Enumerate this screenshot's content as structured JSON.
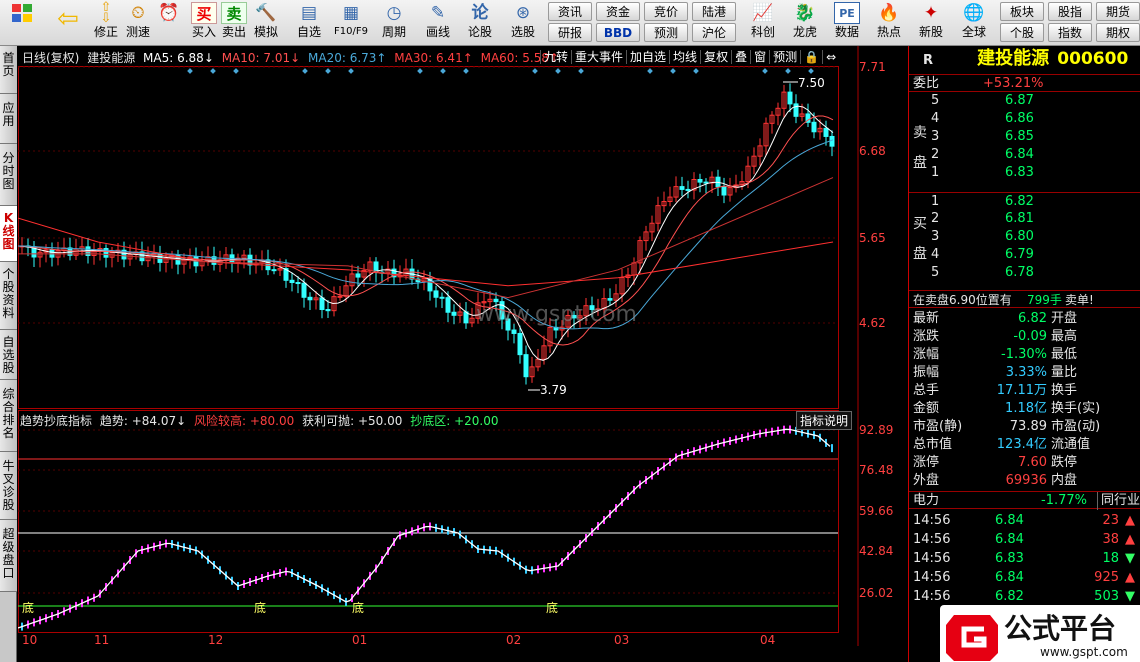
{
  "toolbar": {
    "buttons": [
      {
        "label": "",
        "icon": "grid-icon"
      },
      {
        "label": "",
        "icon": "back-icon"
      },
      {
        "label": "修正",
        "icon": "up-down-icon"
      },
      {
        "label": "测速",
        "icon": "speed-icon"
      },
      {
        "label": "模拟",
        "icon": "clock-icon"
      },
      {
        "label": "买入",
        "icon": "buy-icon",
        "glyph": "买"
      },
      {
        "label": "卖出",
        "icon": "sell-icon",
        "glyph": "卖"
      },
      {
        "label": "模拟",
        "icon": "hammer-icon"
      },
      {
        "label": "自选",
        "icon": "watchlist-icon"
      },
      {
        "label": "F10/F9",
        "icon": "f10-icon"
      },
      {
        "label": "周期",
        "icon": "period-icon"
      },
      {
        "label": "画线",
        "icon": "pen-icon"
      },
      {
        "label": "论股",
        "icon": "forum-icon"
      },
      {
        "label": "选股",
        "icon": "select-stock-icon"
      }
    ],
    "small_top": [
      "资讯",
      "资金",
      "竞价",
      "陆港"
    ],
    "small_bottom": [
      "研报",
      "BBD",
      "预测",
      "沪伦"
    ],
    "buttons2": [
      {
        "label": "科创",
        "icon": "kechuang-icon"
      },
      {
        "label": "龙虎",
        "icon": "dragon-icon"
      },
      {
        "label": "数据",
        "icon": "pe-icon",
        "glyph": "PE"
      },
      {
        "label": "热点",
        "icon": "hot-icon"
      },
      {
        "label": "新股",
        "icon": "new-stock-icon"
      },
      {
        "label": "全球",
        "icon": "globe-icon"
      }
    ],
    "small_right_top": [
      "板块",
      "股指",
      "期货"
    ],
    "small_right_bottom": [
      "个股",
      "指数",
      "期权"
    ]
  },
  "left_tabs": [
    "首页",
    "应用",
    "分时图",
    "K线图",
    "个股资料",
    "自选股",
    "综合排名",
    "牛叉诊股",
    "超级盘口"
  ],
  "main_header": {
    "label": "日线(复权)",
    "stock": "建投能源",
    "ma5": "MA5: 6.88↓",
    "ma10": "MA10: 7.01↓",
    "ma20": "MA20: 6.73↑",
    "ma30": "MA30: 6.41↑",
    "ma60": "MA60: 5.58↑",
    "buttons": [
      "九转",
      "重大事件",
      "加自选",
      "均线",
      "复权",
      "叠",
      "窗",
      "预测"
    ]
  },
  "colors": {
    "ma5": "#ffffff",
    "ma10": "#ffff00",
    "ma20": "#ff00ff",
    "ma30": "#00ff00",
    "ma60": "#888888",
    "up": "#ff3333",
    "down": "#33ffff",
    "grid": "#aa0000",
    "axis_text": "#ff4040"
  },
  "price_axis": {
    "ticks": [
      "7.71",
      "6.68",
      "5.65",
      "4.62"
    ],
    "high_label": "7.50",
    "low_label": "3.79"
  },
  "indicator": {
    "name": "趋势抄底指标",
    "trend": "趋势: +84.07↓",
    "risk": "风险较高: +80.00",
    "profit": "获利可抛: +50.00",
    "bottom": "抄底区: +20.00",
    "button": "指标说明",
    "ticks": [
      "92.89",
      "76.48",
      "59.66",
      "42.84",
      "26.02"
    ],
    "bottom_marks": [
      "底",
      "底",
      "底",
      "底"
    ]
  },
  "x_axis": [
    "10",
    "11",
    "12",
    "01",
    "02",
    "03",
    "04"
  ],
  "chart_data": {
    "type": "line",
    "title": "建投能源",
    "ylim": [
      3.5,
      7.8
    ],
    "x": [
      "10",
      "11",
      "12",
      "01",
      "02",
      "03",
      "04"
    ],
    "series": [
      {
        "name": "MA60",
        "values": [
          5.9,
          5.6,
          5.35,
          5.25,
          5.05,
          5.15,
          5.6
        ]
      },
      {
        "name": "MA30",
        "values": [
          5.45,
          5.45,
          5.35,
          5.3,
          4.9,
          5.25,
          6.41
        ]
      },
      {
        "name": "MA20",
        "values": [
          5.4,
          5.45,
          5.4,
          5.2,
          4.8,
          5.4,
          6.73
        ]
      }
    ],
    "annotations": [
      {
        "label": "7.50"
      },
      {
        "label": "3.79"
      }
    ]
  },
  "right_panel": {
    "tag": "R",
    "name": "建投能源",
    "code": "000600",
    "weibi_label": "委比",
    "weibi": "+53.21%",
    "sell_label": "卖盘",
    "buy_label": "买盘",
    "sell": [
      {
        "lvl": "5",
        "price": "6.87"
      },
      {
        "lvl": "4",
        "price": "6.86"
      },
      {
        "lvl": "3",
        "price": "6.85"
      },
      {
        "lvl": "2",
        "price": "6.84"
      },
      {
        "lvl": "1",
        "price": "6.83"
      }
    ],
    "buy": [
      {
        "lvl": "1",
        "price": "6.82"
      },
      {
        "lvl": "2",
        "price": "6.81"
      },
      {
        "lvl": "3",
        "price": "6.80"
      },
      {
        "lvl": "4",
        "price": "6.79"
      },
      {
        "lvl": "5",
        "price": "6.78"
      }
    ],
    "ask_text": "在卖盘6.90位置有",
    "ask_qty": "799手",
    "ask_flag": "卖单!",
    "stats": [
      {
        "k": "最新",
        "v": "6.82",
        "k2": "开盘",
        "c": "c-green"
      },
      {
        "k": "涨跌",
        "v": "-0.09",
        "k2": "最高",
        "c": "c-green"
      },
      {
        "k": "涨幅",
        "v": "-1.30%",
        "k2": "最低",
        "c": "c-green"
      },
      {
        "k": "振幅",
        "v": "3.33%",
        "k2": "量比",
        "c": "c-cyan"
      },
      {
        "k": "总手",
        "v": "17.11万",
        "k2": "换手",
        "c": "c-cyan"
      },
      {
        "k": "金额",
        "v": "1.18亿",
        "k2": "换手(实)",
        "c": "c-cyan"
      },
      {
        "k": "市盈(静)",
        "v": "73.89",
        "k2": "市盈(动)",
        "c": "c-white"
      },
      {
        "k": "总市值",
        "v": "123.4亿",
        "k2": "流通值",
        "c": "c-cyan"
      },
      {
        "k": "涨停",
        "v": "7.60",
        "k2": "跌停",
        "c": "c-red"
      },
      {
        "k": "外盘",
        "v": "69936",
        "k2": "内盘",
        "c": "c-red"
      }
    ],
    "sector": "电力",
    "sector_pct": "-1.77%",
    "sector_btn": "同行业",
    "ticks": [
      {
        "t": "14:56",
        "p": "6.84",
        "v": "23",
        "dir": "up"
      },
      {
        "t": "14:56",
        "p": "6.84",
        "v": "38",
        "dir": "up"
      },
      {
        "t": "14:56",
        "p": "6.83",
        "v": "18",
        "dir": "down"
      },
      {
        "t": "14:56",
        "p": "6.84",
        "v": "925",
        "dir": "up"
      },
      {
        "t": "14:56",
        "p": "6.82",
        "v": "503",
        "dir": "down"
      }
    ]
  },
  "watermark": {
    "brand": "公式平台",
    "url": "www.gspt.com",
    "center": "www.gspt.com"
  }
}
